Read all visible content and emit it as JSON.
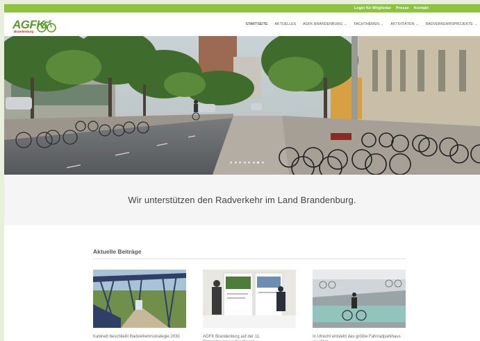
{
  "topbar": {
    "links": [
      "Login für Mitglieder",
      "Presse",
      "Kontakt"
    ]
  },
  "logo": {
    "text": "AGFK",
    "sub": "Brandenburg"
  },
  "nav": {
    "items": [
      {
        "label": "STARTSEITE",
        "dropdown": false,
        "active": true
      },
      {
        "label": "AKTUELLES",
        "dropdown": false
      },
      {
        "label": "AGFK BRANDENBURG",
        "dropdown": true
      },
      {
        "label": "FACHTHEMEN",
        "dropdown": true
      },
      {
        "label": "AKTIVITÄTEN",
        "dropdown": true
      },
      {
        "label": "RADVERKEHRSPROJEKTE",
        "dropdown": true
      }
    ]
  },
  "slider": {
    "count": 8,
    "active_index": 6
  },
  "tagline": "Wir unterstützen den Radverkehr im Land Brandenburg.",
  "recent": {
    "title": "Aktuelle Beiträge",
    "posts": [
      {
        "caption": "Kabinett beschließt Radverkehrsstrategie 2030"
      },
      {
        "caption": "AGFK Brandenburg auf der 11. Fahrradkommunalkonferenz"
      },
      {
        "caption": "In Utrecht entsteht das größte Fahrradparkhaus der Welt"
      }
    ]
  },
  "colors": {
    "brand_green": "#8cc43d",
    "logo_red": "#c8202a"
  }
}
